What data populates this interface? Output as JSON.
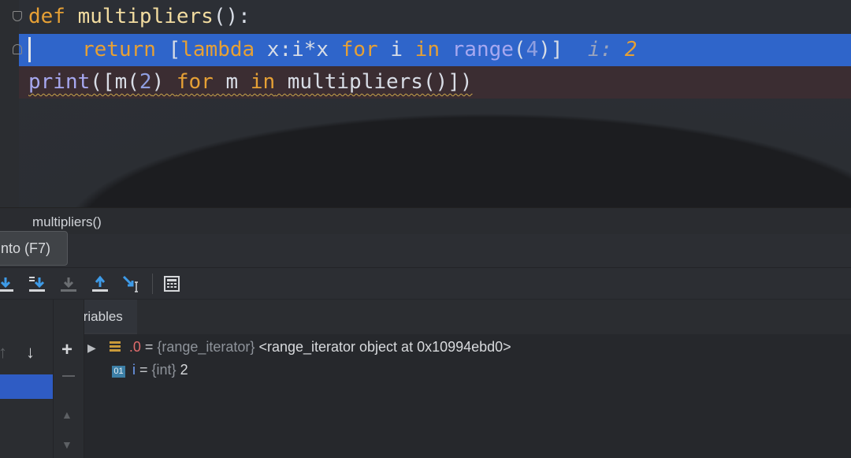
{
  "editor": {
    "line1": {
      "kw_def": "def",
      "fn_name": "multipliers",
      "rest": "():"
    },
    "line2": {
      "kw_return": "return",
      "open": " [",
      "kw_lambda": "lambda",
      "expr": " x:i*x ",
      "kw_for": "for",
      "var_i": " i ",
      "kw_in": "in",
      "space": " ",
      "builtin_range": "range",
      "paren_open": "(",
      "num_4": "4",
      "close": ")]",
      "inline_label": "i:",
      "inline_value": "2"
    },
    "line3": {
      "builtin_print": "print",
      "p1": "([m(",
      "num_2": "2",
      "p2": ") ",
      "kw_for": "for",
      "p3": " m ",
      "kw_in": "in",
      "p4": " multipliers()])"
    }
  },
  "frames": {
    "current": "multipliers()"
  },
  "tooltip": {
    "text": "nto (F7)"
  },
  "toolbar": {
    "icons": [
      "step-into-icon",
      "force-step-into-icon",
      "step-into-my-code-icon",
      "step-out-icon",
      "run-to-cursor-icon",
      "evaluate-expression-icon"
    ]
  },
  "variables": {
    "tab_label": "Variables",
    "rows": [
      {
        "name": ".0",
        "eq": " = ",
        "type": "{range_iterator}",
        "value": " <range_iterator object at 0x10994ebd0>"
      },
      {
        "badge": "01",
        "name": "i",
        "eq": " = ",
        "type": "{int}",
        "value": " 2"
      }
    ]
  },
  "colors": {
    "execution_line": "#2f65ca",
    "breakpoint_line": "#3b2d32",
    "keyword": "#e6a035",
    "accent_blue": "#2f5cc4"
  }
}
